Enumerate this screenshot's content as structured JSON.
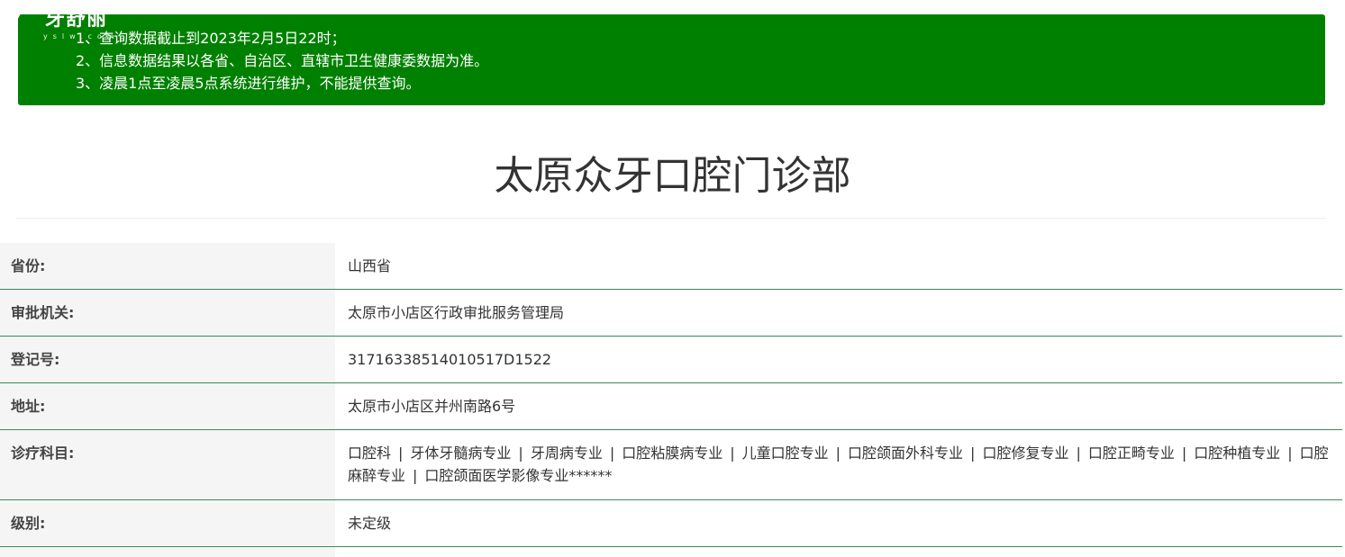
{
  "logo": {
    "brand_text": "牙舒丽",
    "sub_text": "yslw.com"
  },
  "notice": {
    "lines": [
      "1、查询数据截止到2023年2月5日22时；",
      "2、信息数据结果以各省、自治区、直辖市卫生健康委数据为准。",
      "3、凌晨1点至凌晨5点系统进行维护，不能提供查询。"
    ],
    "background_color": "#008000"
  },
  "page_title": "太原众牙口腔门诊部",
  "info": {
    "province": {
      "label": "省份:",
      "value": "山西省"
    },
    "authority": {
      "label": "审批机关:",
      "value": "太原市小店区行政审批服务管理局"
    },
    "registration": {
      "label": "登记号:",
      "value": "31716338514010517D1522"
    },
    "address": {
      "label": "地址:",
      "value": "太原市小店区并州南路6号"
    },
    "departments": {
      "label": "诊疗科目:",
      "items": [
        "口腔科",
        "牙体牙髓病专业",
        "牙周病专业",
        "口腔粘膜病专业",
        "儿童口腔专业",
        "口腔颌面外科专业",
        "口腔修复专业",
        "口腔正畸专业",
        "口腔种植专业",
        "口腔麻醉专业",
        "口腔颌面医学影像专业******"
      ],
      "separator": "|"
    },
    "level": {
      "label": "级别:",
      "value": "未定级"
    }
  },
  "colors": {
    "row_border": "#3a8a5c",
    "label_background": "#f5f5f5",
    "title_text": "#333333"
  }
}
